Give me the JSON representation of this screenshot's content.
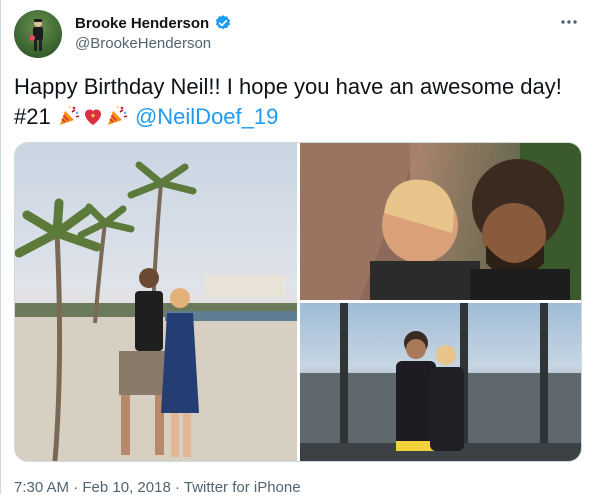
{
  "author": {
    "display_name": "Brooke Henderson",
    "handle": "@BrookeHenderson",
    "verified": true,
    "avatar_icon": "golfer-avatar"
  },
  "tweet": {
    "text_before": "Happy Birthday Neil!! I hope you have an awesome day! #21 ",
    "emojis": [
      "party-popper-icon",
      "sparkling-heart-icon",
      "party-popper-icon"
    ],
    "mention": "@NeilDoef_19"
  },
  "media": [
    {
      "name": "beach-photo"
    },
    {
      "name": "selfie-photo"
    },
    {
      "name": "building-photo"
    }
  ],
  "meta": {
    "time": "7:30 AM",
    "separator": " · ",
    "date": "Feb 10, 2018",
    "source": "Twitter for iPhone"
  },
  "colors": {
    "link": "#1d9bf0",
    "verified_badge": "#1d9bf0",
    "secondary_text": "#536471",
    "border": "#cfd9de"
  }
}
